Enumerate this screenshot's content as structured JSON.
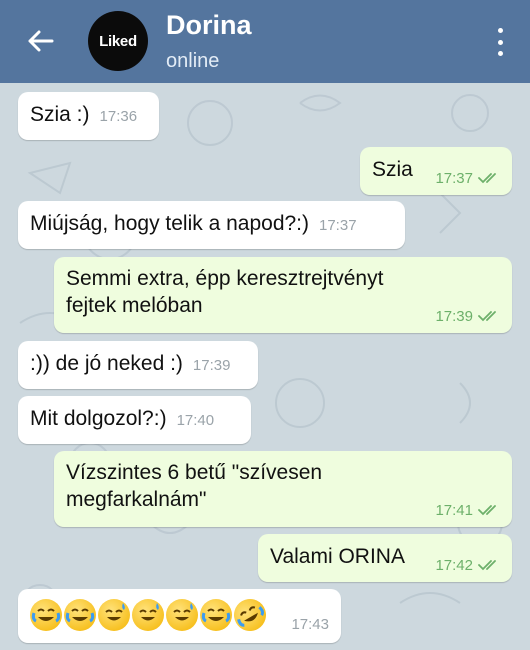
{
  "header": {
    "back_icon": "arrow-left-icon",
    "avatar_text": "Liked",
    "title": "Dorina",
    "status": "online",
    "menu_icon": "more-vertical-icon",
    "color": "#54759e"
  },
  "messages": [
    {
      "dir": "in",
      "text": "Szia :)",
      "time": "17:36"
    },
    {
      "dir": "out",
      "text": "Szia",
      "time": "17:37",
      "status_icon": "double-check-icon"
    },
    {
      "dir": "in",
      "text": "Miújság, hogy telik a napod?:)",
      "time": "17:37"
    },
    {
      "dir": "out",
      "text_lines": [
        "Semmi extra, épp keresztrejtvényt",
        "fejtek melóban"
      ],
      "time": "17:39",
      "status_icon": "double-check-icon"
    },
    {
      "dir": "in",
      "text": ":)) de jó neked :)",
      "time": "17:39"
    },
    {
      "dir": "in",
      "text": "Mit dolgozol?:)",
      "time": "17:40"
    },
    {
      "dir": "out",
      "text_lines": [
        "Vízszintes 6 betű \"szívesen",
        "megfarkalnám\""
      ],
      "time": "17:41",
      "status_icon": "double-check-icon"
    },
    {
      "dir": "out",
      "text": "Valami ORINA",
      "time": "17:42",
      "status_icon": "double-check-icon"
    },
    {
      "dir": "in",
      "emoji": [
        "joy-emoji",
        "joy-emoji",
        "sweat-smile-emoji",
        "sweat-smile-emoji",
        "sweat-smile-emoji",
        "joy-emoji",
        "rofl-emoji"
      ],
      "time": "17:43"
    }
  ],
  "colors": {
    "incoming_bubble": "#ffffff",
    "outgoing_bubble": "#effdde",
    "read_check": "#6db06a",
    "chat_background": "#cdd8de"
  }
}
